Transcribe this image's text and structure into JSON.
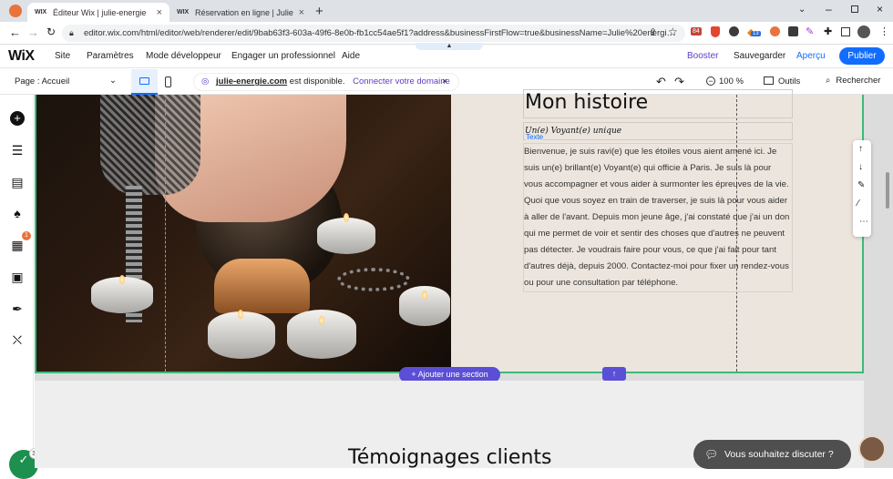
{
  "browser": {
    "tabs": [
      {
        "favicon": "WIX",
        "title": "Éditeur Wix | julie-energie",
        "active": true
      },
      {
        "favicon": "WIX",
        "title": "Réservation en ligne | Julie Energ…",
        "active": false
      }
    ],
    "new_tab": "+",
    "url": "editor.wix.com/html/editor/web/renderer/edit/9bab63f3-603a-49f6-8e0b-fb1cc54ae5f1?address&businessFirstFlow=true&businessName=Julie%20energi…",
    "ext_badges": [
      "84",
      "13"
    ]
  },
  "wix": {
    "logo": "WiX",
    "menu": [
      "Site",
      "Paramètres",
      "Mode développeur",
      "Engager un professionnel",
      "Aide"
    ],
    "booster": "Booster",
    "save": "Sauvegarder",
    "preview": "Aperçu",
    "publish": "Publier",
    "page_label": "Page : Accueil",
    "domain": "julie-energie.com",
    "domain_suffix": " est disponible.",
    "connect_domain": "Connecter votre domaine",
    "zoom": "100 %",
    "tools": "Outils",
    "search": "Rechercher",
    "rail_badge": "1"
  },
  "content": {
    "heading": "Mon histoire",
    "subheading": "Un(e) Voyant(e) unique",
    "text_tag": "Texte",
    "paragraph": "Bienvenue, je suis ravi(e) que les étoiles vous aient amené ici. Je suis un(e) brillant(e) Voyant(e) qui officie à Paris. Je suis là pour vous accompagner et vous aider à surmonter les épreuves de la vie. Quoi que vous soyez en train de traverser, je suis là pour vous aider à aller de l'avant. Depuis mon jeune âge, j'ai constaté que j'ai un don qui me permet de voir et sentir des choses que d'autres ne peuvent pas détecter. Je voudrais faire pour vous, ce que j'ai fait pour tant d'autres déjà, depuis 2000. Contactez-moi pour fixer un rendez-vous ou pour une consultation par téléphone.",
    "add_section": "+ Ajouter une section",
    "next_title": "Témoignages clients",
    "chat": "Vous souhaitez discuter ?",
    "corner_badge": "33"
  }
}
